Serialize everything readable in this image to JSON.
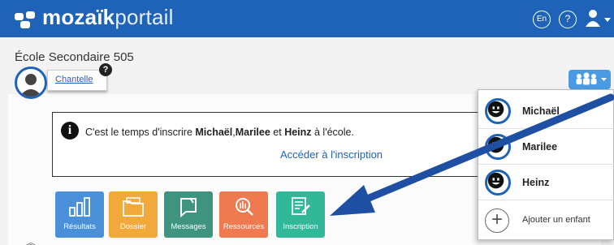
{
  "header": {
    "logo_bold": "mozaïk",
    "logo_light": "portail",
    "lang_label": "En",
    "help_label": "?"
  },
  "school": {
    "name": "École Secondaire 505"
  },
  "user": {
    "name": "Chantelle",
    "help_badge": "?"
  },
  "notice": {
    "text_before": "C'est le temps d'inscrire ",
    "child1": "Michaël",
    "sep1": ",",
    "child2": "Marilee",
    "sep2": " et ",
    "child3": "Heinz",
    "text_after": " à l'école.",
    "link": "Accéder à l'inscription"
  },
  "tiles": [
    {
      "label": "Résultats",
      "color": "#4a90d9",
      "icon": "chart-icon"
    },
    {
      "label": "Dossier",
      "color": "#f2a93b",
      "icon": "folder-icon"
    },
    {
      "label": "Messages",
      "color": "#3f9480",
      "icon": "message-icon"
    },
    {
      "label": "Ressources",
      "color": "#f07a4f",
      "icon": "resources-icon"
    },
    {
      "label": "Inscription",
      "color": "#31b899",
      "icon": "registration-icon"
    }
  ],
  "children_menu": {
    "items": [
      {
        "name": "Michaël"
      },
      {
        "name": "Marilee"
      },
      {
        "name": "Heinz"
      }
    ],
    "add_label": "Ajouter un enfant"
  },
  "colors": {
    "brand": "#1e63b8",
    "arrow": "#1e4fa3"
  }
}
